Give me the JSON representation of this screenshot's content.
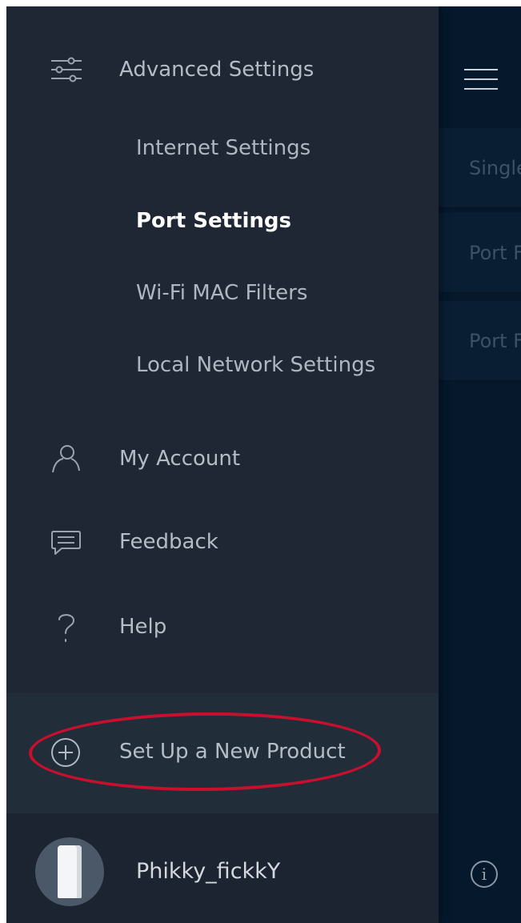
{
  "drawer": {
    "advanced_settings": {
      "label": "Advanced Settings",
      "icon": "sliders-icon",
      "sub_items": [
        {
          "label": "Internet Settings",
          "active": false
        },
        {
          "label": "Port Settings",
          "active": true
        },
        {
          "label": "Wi-Fi MAC Filters",
          "active": false
        },
        {
          "label": "Local Network Settings",
          "active": false
        }
      ]
    },
    "items": [
      {
        "label": "My Account",
        "icon": "user-icon"
      },
      {
        "label": "Feedback",
        "icon": "chat-bubble-icon"
      },
      {
        "label": "Help",
        "icon": "question-mark-icon"
      }
    ],
    "setup": {
      "label": "Set Up a New Product",
      "icon": "plus-circle-icon"
    },
    "profile": {
      "name": "Phikky_fickkY",
      "icon": "velop-node-icon"
    }
  },
  "main": {
    "menu_icon": "hamburger-icon",
    "rows": [
      {
        "label": "Single"
      },
      {
        "label": "Port F"
      },
      {
        "label": "Port F"
      }
    ],
    "info_icon": "info-icon",
    "info_glyph": "i"
  },
  "colors": {
    "drawer_bg": "#1e2733",
    "main_bg": "#05182c",
    "highlight": "#c8102e",
    "active_text": "#ffffff"
  }
}
